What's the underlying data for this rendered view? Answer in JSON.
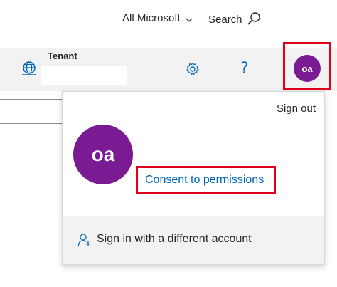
{
  "topnav": {
    "all_microsoft": "All Microsoft",
    "search": "Search"
  },
  "header": {
    "tenant_label": "Tenant",
    "avatar_initials": "oa"
  },
  "account_panel": {
    "sign_out": "Sign out",
    "avatar_initials": "oa",
    "consent_link": "Consent to permissions",
    "sign_in_different": "Sign in with a different account"
  },
  "colors": {
    "accent": "#0067b8",
    "avatar": "#7b1b94",
    "highlight": "#e1001a"
  },
  "icons": [
    "chevron-down-icon",
    "search-icon",
    "globe-icon",
    "gear-icon",
    "help-icon",
    "add-person-icon"
  ]
}
